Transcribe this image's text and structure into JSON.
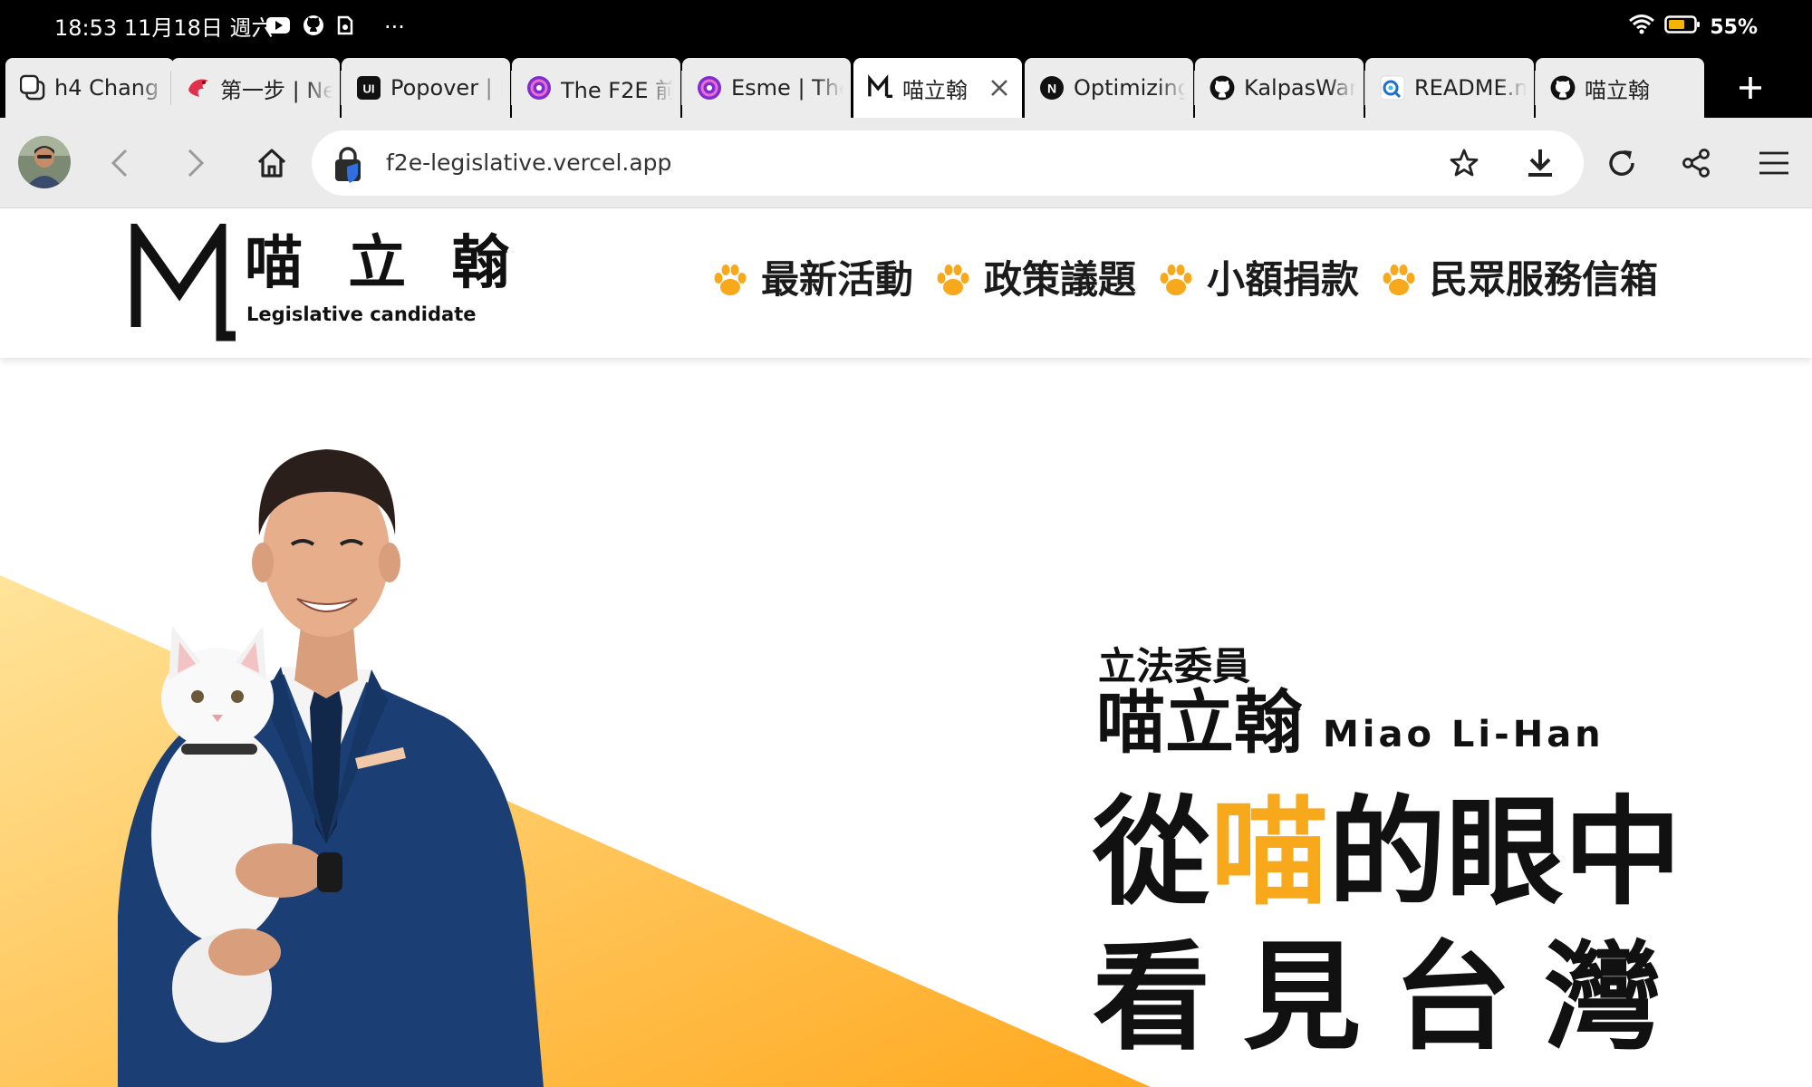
{
  "status_bar": {
    "time": "18:53 11月18日 週六",
    "more": "···",
    "battery": "55%",
    "app_icons": [
      "youtube-icon",
      "github-icon",
      "notification-app-icon"
    ]
  },
  "tabs": [
    {
      "title": "h4 Chang",
      "favicon": "tab-overview-icon"
    },
    {
      "title": "第一步 | Ne",
      "favicon": "dragon-icon"
    },
    {
      "title": "Popover | M",
      "favicon": "ui-icon"
    },
    {
      "title": "The F2E 前",
      "favicon": "purple-swirl-icon"
    },
    {
      "title": "Esme | The",
      "favicon": "purple-swirl-icon"
    },
    {
      "title": "喵立翰",
      "favicon": "ml-logo-icon",
      "active": true
    },
    {
      "title": "Optimizing",
      "favicon": "notion-icon"
    },
    {
      "title": "KalpasWar",
      "favicon": "github-icon"
    },
    {
      "title": "README.m",
      "favicon": "readme-icon"
    },
    {
      "title": "喵立翰",
      "favicon": "github-icon"
    }
  ],
  "toolbar": {
    "url": "f2e-legislative.vercel.app"
  },
  "site": {
    "logo_name": "喵 立 翰",
    "logo_sub": "Legislative candidate",
    "nav": [
      "最新活動",
      "政策議題",
      "小額捐款",
      "民眾服務信箱"
    ]
  },
  "hero": {
    "role": "立法委員",
    "name_cn": "喵立翰",
    "name_en": "Miao Li-Han",
    "slogan_line1_a": "從",
    "slogan_line1_highlight": "喵",
    "slogan_line1_b": "的眼中",
    "slogan_line2": "看見台灣"
  },
  "colors": {
    "accent": "#f7a81b",
    "gradient_light": "#ffe49a",
    "gradient_dark": "#ffa91f",
    "suit": "#1b3f74"
  }
}
